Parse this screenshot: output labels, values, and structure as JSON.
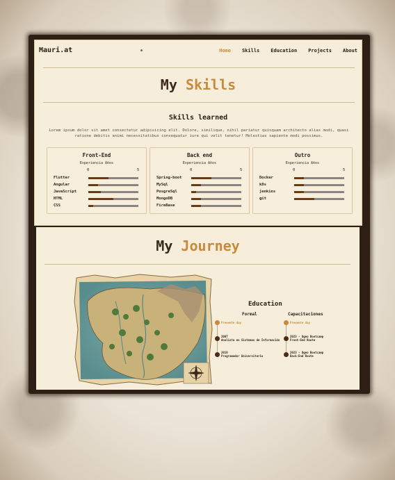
{
  "nav": {
    "brand": "Mauri.at",
    "links": [
      "Home",
      "Skills",
      "Education",
      "Projects",
      "About"
    ]
  },
  "skills": {
    "title_prefix": "My",
    "title_accent": "Skills",
    "subtitle": "Skills learned",
    "intro": "Lorem ipsum dolor sit amet consectetur adipisicing elit. Dolore, similique, nihil pariatur quisquam architecto alias modi, quasi ratione debitis animi necessitatibus consequatur iure qui velit tenetur! Molestias sapiente modi possimus.",
    "cards": [
      {
        "title": "Front-End",
        "caption": "Experiencia Años",
        "scale_min": "0",
        "scale_max": "5",
        "items": [
          {
            "name": "Flutter",
            "level": 0.4
          },
          {
            "name": "Angular",
            "level": 0.2
          },
          {
            "name": "JavaScript",
            "level": 0.25
          },
          {
            "name": "HTML",
            "level": 0.5
          },
          {
            "name": "CSS",
            "level": 0.1
          }
        ]
      },
      {
        "title": "Back end",
        "caption": "Experiencia Años",
        "scale_min": "0",
        "scale_max": "5",
        "items": [
          {
            "name": "Spring-boot",
            "level": 0.4
          },
          {
            "name": "MySql",
            "level": 0.2
          },
          {
            "name": "PosgreSql",
            "level": 0.1
          },
          {
            "name": "MongoDB",
            "level": 0.2
          },
          {
            "name": "FireBase",
            "level": 0.2
          }
        ]
      },
      {
        "title": "Outro",
        "caption": "Experiencia Años",
        "scale_min": "0",
        "scale_max": "5",
        "items": [
          {
            "name": "Docker",
            "level": 0.2
          },
          {
            "name": "k8s",
            "level": 0.2
          },
          {
            "name": "jenkins",
            "level": 0.2
          },
          {
            "name": "git",
            "level": 0.4
          }
        ]
      }
    ]
  },
  "journey": {
    "title_prefix": "My",
    "title_accent": "Journey",
    "education_title": "Education",
    "formal_head": "Formal",
    "capacitaciones_head": "Capacitaciones",
    "formal": [
      {
        "text": "Presente day"
      },
      {
        "text": "2007\nAnalista en Sistemas de Información"
      },
      {
        "text": "2016\nProgramador Universitario"
      }
    ],
    "capacitaciones": [
      {
        "text": "Presente day"
      },
      {
        "text": "2023 - Ogeo Bootcamp\nFront-End Route"
      },
      {
        "text": "2023 - Ogeo Bootcamp\nBack-End Route"
      }
    ]
  },
  "colors": {
    "accent": "#c8893a",
    "dark": "#2a1c10",
    "paper": "#f6eedb"
  }
}
